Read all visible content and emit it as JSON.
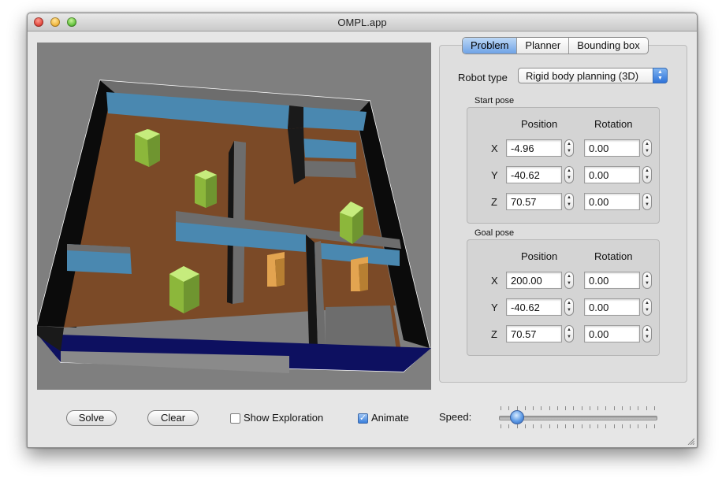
{
  "window": {
    "title": "OMPL.app"
  },
  "tabs": [
    {
      "label": "Problem",
      "active": true
    },
    {
      "label": "Planner",
      "active": false
    },
    {
      "label": "Bounding box",
      "active": false
    }
  ],
  "problem": {
    "robot_type_label": "Robot type",
    "robot_type_value": "Rigid body planning (3D)",
    "position_label": "Position",
    "rotation_label": "Rotation",
    "start_pose": {
      "label": "Start pose",
      "x": {
        "axis": "X",
        "position": "-4.96",
        "rotation": "0.00"
      },
      "y": {
        "axis": "Y",
        "position": "-40.62",
        "rotation": "0.00"
      },
      "z": {
        "axis": "Z",
        "position": "70.57",
        "rotation": "0.00"
      }
    },
    "goal_pose": {
      "label": "Goal pose",
      "x": {
        "axis": "X",
        "position": "200.00",
        "rotation": "0.00"
      },
      "y": {
        "axis": "Y",
        "position": "-40.62",
        "rotation": "0.00"
      },
      "z": {
        "axis": "Z",
        "position": "70.57",
        "rotation": "0.00"
      }
    }
  },
  "controls": {
    "solve_label": "Solve",
    "clear_label": "Clear",
    "show_exploration_label": "Show Exploration",
    "show_exploration_checked": false,
    "animate_label": "Animate",
    "animate_checked": true,
    "speed_label": "Speed:",
    "speed_level": 0.1
  },
  "colors": {
    "floor": "#7b4a27",
    "wall_blue": "#4a88b0",
    "wall_gray": "#6c6c6c",
    "obstacle_green": "#a9d653",
    "robot_orange": "#e3a450",
    "base_navy": "#0d1060",
    "accent": "#3a7fdc"
  },
  "icons": {
    "stepper": "up-down-stepper-icon",
    "select_arrows": "up-down-arrows-icon",
    "resize": "resize-grip-icon"
  }
}
